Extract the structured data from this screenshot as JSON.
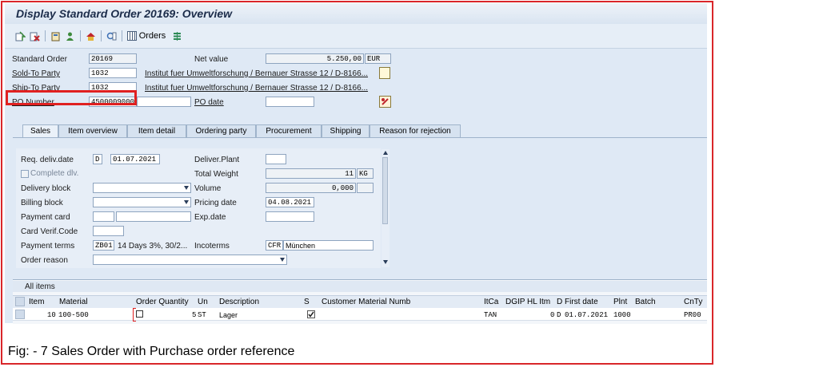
{
  "window": {
    "title": "Display Standard Order 20169: Overview"
  },
  "toolbar": {
    "orders_label": "Orders"
  },
  "header": {
    "standard_order_label": "Standard Order",
    "standard_order_value": "20169",
    "net_value_label": "Net value",
    "net_value_value": "5.250,00",
    "currency": "EUR",
    "sold_to_label": "Sold-To Party",
    "sold_to_value": "1032",
    "sold_to_text": "Institut fuer Umweltforschung / Bernauer Strasse 12 / D-8166...",
    "ship_to_label": "Ship-To Party",
    "ship_to_value": "1032",
    "ship_to_text": "Institut fuer Umweltforschung / Bernauer Strasse 12 / D-8166...",
    "po_number_label": "PO Number",
    "po_number_value": "4500009000",
    "po_date_label": "PO date"
  },
  "tabs": [
    "Sales",
    "Item overview",
    "Item detail",
    "Ordering party",
    "Procurement",
    "Shipping",
    "Reason for rejection"
  ],
  "sales": {
    "req_deliv_date_label": "Req. deliv.date",
    "req_deliv_date_type": "D",
    "req_deliv_date_value": "01.07.2021",
    "deliver_plant_label": "Deliver.Plant",
    "complete_dlv_label": "Complete dlv.",
    "total_weight_label": "Total Weight",
    "total_weight_value": "11",
    "total_weight_unit": "KG",
    "delivery_block_label": "Delivery block",
    "volume_label": "Volume",
    "volume_value": "0,000",
    "billing_block_label": "Billing block",
    "pricing_date_label": "Pricing date",
    "pricing_date_value": "04.08.2021",
    "payment_card_label": "Payment card",
    "exp_date_label": "Exp.date",
    "card_verif_label": "Card Verif.Code",
    "payment_terms_label": "Payment terms",
    "payment_terms_value": "ZB01",
    "payment_terms_text": "14 Days 3%, 30/2...",
    "incoterms_label": "Incoterms",
    "incoterms_value": "CFR",
    "incoterms_place": "München",
    "order_reason_label": "Order reason"
  },
  "items": {
    "title": "All items",
    "columns": [
      "Item",
      "Material",
      "Order Quantity",
      "Un",
      "Description",
      "S",
      "Customer Material Numb",
      "ItCa",
      "DGIP",
      "HL Itm",
      "D",
      "First date",
      "Plnt",
      "Batch",
      "CnTy"
    ],
    "row": {
      "item": "10",
      "material": "100-500",
      "qty": "5",
      "un": "ST",
      "description": "Lager",
      "itca": "TAN",
      "hl_itm": "0",
      "d": "D",
      "first_date": "01.07.2021",
      "plnt": "1000",
      "cnty": "PR00"
    }
  },
  "caption": "Fig: - 7 Sales Order with Purchase order reference",
  "colors": {
    "highlight": "#e02020",
    "frame": "#d9262a",
    "sap_bg": "#dfe9f5"
  }
}
